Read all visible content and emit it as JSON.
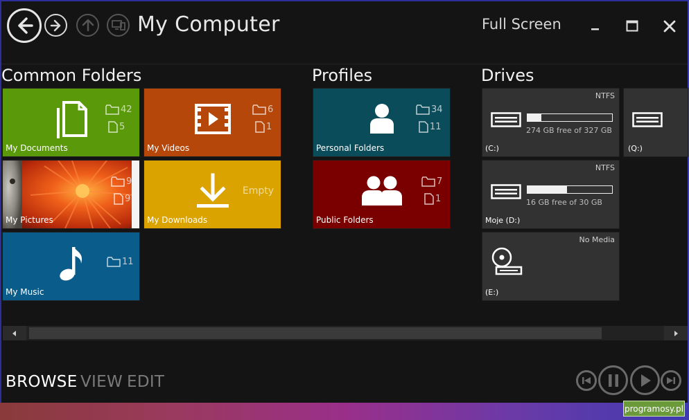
{
  "window": {
    "title": "My Computer",
    "fullscreen_label": "Full Screen",
    "minimize_glyph": "_",
    "maximize_glyph": "☐",
    "close_glyph": "✕"
  },
  "sections": {
    "common_folders": "Common Folders",
    "profiles": "Profiles",
    "drives": "Drives"
  },
  "tiles": {
    "documents": {
      "label": "My Documents",
      "folders": "42",
      "files": "5",
      "color": "#5a9a0a",
      "icon": "documents-icon"
    },
    "videos": {
      "label": "My Videos",
      "folders": "6",
      "files": "1",
      "color": "#b5470a",
      "icon": "film-icon"
    },
    "pictures": {
      "label": "My Pictures",
      "folders": "9",
      "files": "9",
      "color": "#d2401a",
      "icon": "photo-thumbnail"
    },
    "downloads": {
      "label": "My Downloads",
      "empty": "Empty",
      "color": "#dba300",
      "icon": "download-icon"
    },
    "music": {
      "label": "My Music",
      "folders": "11",
      "color": "#0a5c8a",
      "icon": "music-note-icon"
    },
    "personal": {
      "label": "Personal Folders",
      "folders": "34",
      "files": "11",
      "color": "#0a4c5a",
      "icon": "user-icon"
    },
    "public": {
      "label": "Public Folders",
      "folders": "7",
      "files": "1",
      "color": "#7a0000",
      "icon": "users-icon"
    }
  },
  "drives": {
    "c": {
      "label": "(C:)",
      "fs": "NTFS",
      "free_text": "274 GB free of 327 GB",
      "used_fraction": 0.16
    },
    "q": {
      "label": "(Q:)"
    },
    "d": {
      "label": "Moje (D:)",
      "fs": "NTFS",
      "free_text": "16 GB free of 30 GB",
      "used_fraction": 0.47
    },
    "e": {
      "label": "(E:)",
      "fs": "No Media"
    }
  },
  "bottom_nav": {
    "browse": "BROWSE",
    "view": "VIEW",
    "edit": "EDIT"
  },
  "watermark": "programosy.pl",
  "colors": {
    "background": "#141414",
    "drive_tile": "#323232",
    "active_tab": "#ffffff",
    "inactive_tab": "#7a7a7a"
  }
}
